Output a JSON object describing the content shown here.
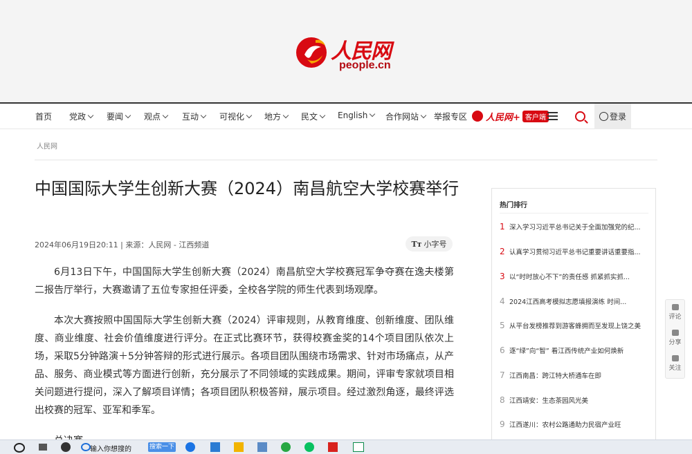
{
  "logo": {
    "name": "人民网",
    "domain": "people.cn"
  },
  "nav": {
    "items": [
      {
        "label": "首页",
        "caret": false
      },
      {
        "label": "党政",
        "caret": true
      },
      {
        "label": "要闻",
        "caret": true
      },
      {
        "label": "观点",
        "caret": true
      },
      {
        "label": "互动",
        "caret": true
      },
      {
        "label": "可视化",
        "caret": true
      },
      {
        "label": "地方",
        "caret": true
      },
      {
        "label": "民文",
        "caret": true
      },
      {
        "label": "English",
        "caret": true
      },
      {
        "label": "合作网站",
        "caret": true
      },
      {
        "label": "举报专区",
        "caret": false
      }
    ],
    "app_name": "人民网+",
    "app_tag": "客户端",
    "login": "登录"
  },
  "breadcrumb": "人民网",
  "article": {
    "title": "中国国际大学生创新大赛（2024）南昌航空大学校赛举行",
    "meta": "2024年06月19日20:11 | 来源：人民网 - 江西频道",
    "font_toggle": "小字号",
    "font_toggle_icon": "Tт",
    "paragraphs": [
      "6月13日下午，中国国际大学生创新大赛（2024）南昌航空大学校赛冠军争夺赛在逸夫楼第二报告厅举行，大赛邀请了五位专家担任评委，全校各学院的师生代表到场观摩。",
      "本次大赛按照中国国际大学生创新大赛（2024）评审规则，从教育维度、创新维度、团队维度、商业维度、社会价值维度进行评分。在正式比赛环节，获得校赛金奖的14个项目团队依次上场，采取5分钟路演＋5分钟答辩的形式进行展示。各项目团队围绕市场需求、针对市场痛点，从产品、服务、商业模式等方面进行创新，充分展示了不同领域的实践成果。期间，评审专家就项目相关问题进行提问，深入了解项目详情；各项目团队积极答辩，展示项目。经过激烈角逐，最终评选出校赛的冠军、亚军和季军。",
      "总决赛……"
    ]
  },
  "sidebar": {
    "title": "热门排行",
    "items": [
      {
        "rank": "1",
        "text": "深入学习习近平总书记关于全面加强党的纪..."
      },
      {
        "rank": "2",
        "text": "认真学习贯彻习近平总书记重要讲话重要指..."
      },
      {
        "rank": "3",
        "text": "以“时时放心不下”的责任感 抓紧抓实抓..."
      },
      {
        "rank": "4",
        "text": "2024江西高考模拟志愿填报演练 时间..."
      },
      {
        "rank": "5",
        "text": "从平台发榜推荐到游客蜂拥而至发现上饶之美"
      },
      {
        "rank": "6",
        "text": "逐“绿”向“智” 看江西传统产业如何焕新"
      },
      {
        "rank": "7",
        "text": "江西南昌：跨江特大桥通车在即"
      },
      {
        "rank": "8",
        "text": "江西靖安：生态茶园风光美"
      },
      {
        "rank": "9",
        "text": "江西遂川：农村公路通助力民宿产业旺"
      }
    ]
  },
  "float_tools": [
    {
      "label": "评论",
      "icon": "comment-icon"
    },
    {
      "label": "分享",
      "icon": "share-icon"
    },
    {
      "label": "关注",
      "icon": "follow-icon"
    }
  ],
  "taskbar": {
    "search_text": "输入你想搜的",
    "search_button": "搜索一下"
  },
  "colors": {
    "brand": "#d80a12",
    "header_bg": "#f4f4f4"
  }
}
